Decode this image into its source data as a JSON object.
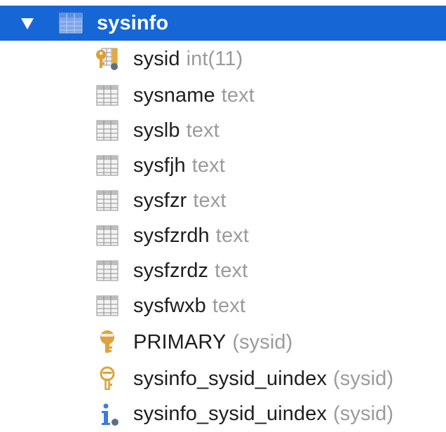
{
  "table": {
    "name": "sysinfo",
    "expanded": true,
    "selected": true,
    "icon": "table-icon",
    "colors": {
      "selection": "#1766d6",
      "name": "#1e1e1e",
      "type": "#9b9b9b"
    }
  },
  "columns": [
    {
      "name": "sysid",
      "type": "int(11)",
      "icon": "primary-key-column-icon"
    },
    {
      "name": "sysname",
      "type": "text",
      "icon": "column-icon"
    },
    {
      "name": "syslb",
      "type": "text",
      "icon": "column-icon"
    },
    {
      "name": "sysfjh",
      "type": "text",
      "icon": "column-icon"
    },
    {
      "name": "sysfzr",
      "type": "text",
      "icon": "column-icon"
    },
    {
      "name": "sysfzrdh",
      "type": "text",
      "icon": "column-icon"
    },
    {
      "name": "sysfzrdz",
      "type": "text",
      "icon": "column-icon"
    },
    {
      "name": "sysfwxb",
      "type": "text",
      "icon": "column-icon"
    }
  ],
  "indexes": [
    {
      "name": "PRIMARY",
      "detail": "(sysid)",
      "icon": "primary-key-icon"
    },
    {
      "name": "sysinfo_sysid_uindex",
      "detail": "(sysid)",
      "icon": "unique-key-icon"
    },
    {
      "name": "sysinfo_sysid_uindex",
      "detail": "(sysid)",
      "icon": "index-info-icon"
    }
  ]
}
